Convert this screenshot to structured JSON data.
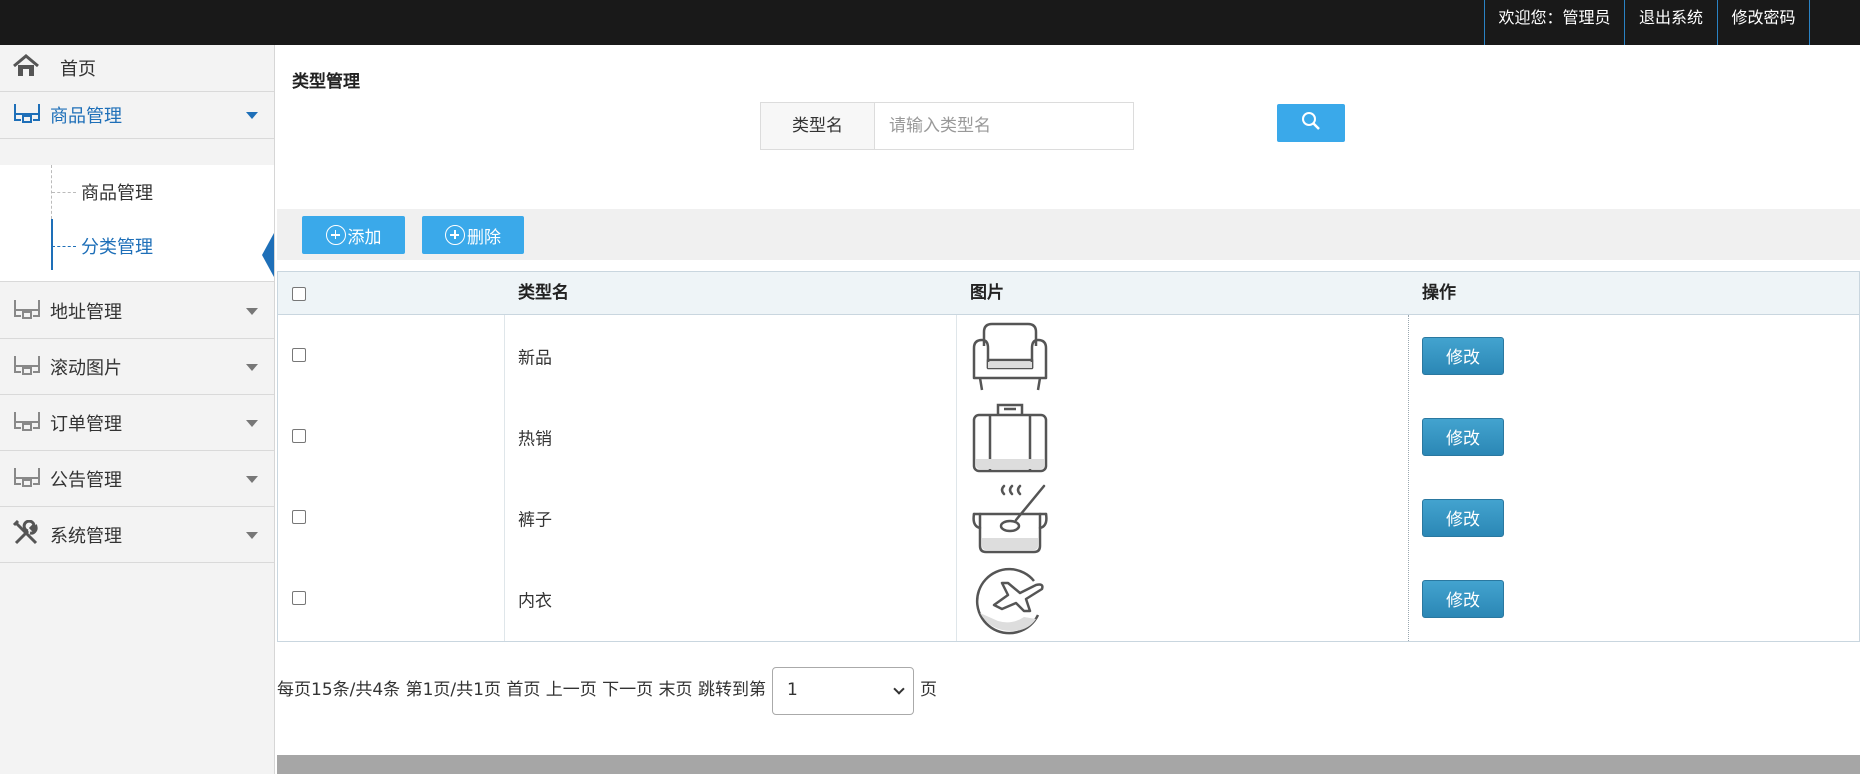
{
  "topbar": {
    "welcome": "欢迎您：管理员",
    "logout": "退出系统",
    "change_password": "修改密码"
  },
  "sidebar": {
    "home": "首页",
    "groups": [
      {
        "label": "商品管理",
        "expanded": true,
        "children": [
          {
            "label": "商品管理"
          },
          {
            "label": "分类管理",
            "active": true
          }
        ]
      },
      {
        "label": "地址管理"
      },
      {
        "label": "滚动图片"
      },
      {
        "label": "订单管理"
      },
      {
        "label": "公告管理"
      },
      {
        "label": "系统管理"
      }
    ]
  },
  "main": {
    "title": "类型管理",
    "search": {
      "label": "类型名",
      "placeholder": "请输入类型名",
      "value": ""
    },
    "toolbar": {
      "add": "添加",
      "delete": "删除"
    },
    "table": {
      "headers": [
        "类型名",
        "图片",
        "操作"
      ],
      "rows": [
        {
          "name": "新品",
          "icon": "armchair-icon",
          "action": "修改"
        },
        {
          "name": "热销",
          "icon": "suitcase-icon",
          "action": "修改"
        },
        {
          "name": "裤子",
          "icon": "cooking-pot-icon",
          "action": "修改"
        },
        {
          "name": "内衣",
          "icon": "airplane-icon",
          "action": "修改"
        }
      ]
    },
    "pager": {
      "text": "每页15条/共4条 第1页/共1页 首页 上一页 下一页 末页 跳转到第",
      "page_value": "1",
      "suffix": "页"
    }
  },
  "colors": {
    "accent_blue": "#3aa9ea",
    "edit_button": "#2b87b5",
    "active_text": "#1e6fb8",
    "topbar": "#191919"
  }
}
